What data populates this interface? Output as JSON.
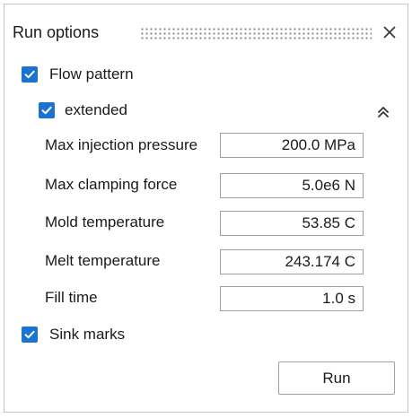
{
  "window": {
    "title": "Run options"
  },
  "options": {
    "flow_pattern": {
      "label": "Flow pattern",
      "checked": true
    },
    "extended": {
      "label": "extended",
      "checked": true
    },
    "sink_marks": {
      "label": "Sink marks",
      "checked": true
    }
  },
  "fields": [
    {
      "label": "Max injection pressure",
      "value": "200.0 MPa"
    },
    {
      "label": "Max clamping force",
      "value": "5.0e6 N"
    },
    {
      "label": "Mold temperature",
      "value": "53.85 C"
    },
    {
      "label": "Melt temperature",
      "value": "243.174 C"
    },
    {
      "label": "Fill time",
      "value": "1.0 s"
    }
  ],
  "actions": {
    "run_label": "Run"
  },
  "colors": {
    "checkbox_accent": "#1a73d0",
    "border": "#c6c6c6"
  },
  "icons": {
    "close": "close-icon",
    "collapse": "double-chevron-up-icon",
    "check": "checkmark-icon"
  }
}
